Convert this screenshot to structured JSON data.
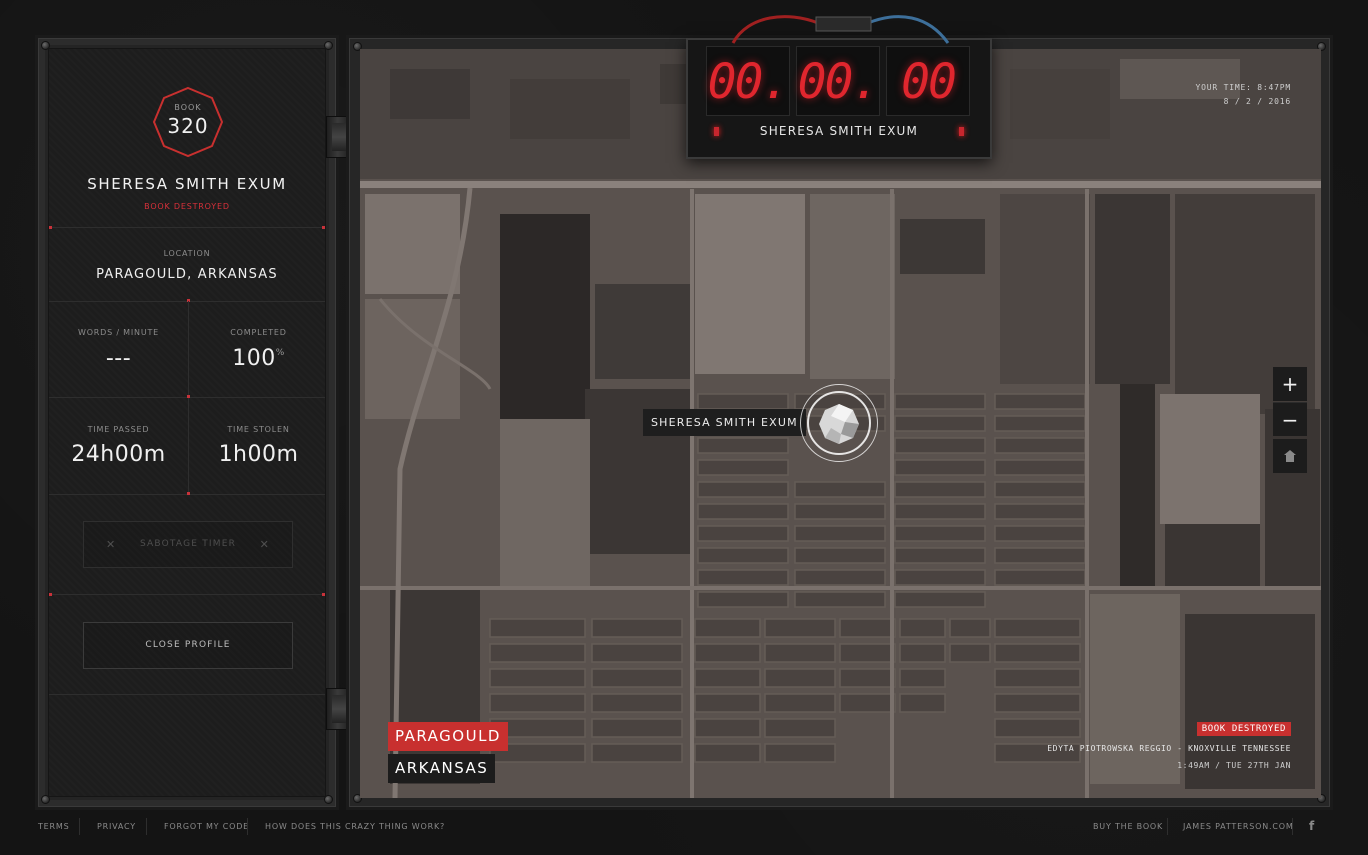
{
  "profile": {
    "book_label": "BOOK",
    "book_number": "320",
    "name": "SHERESA SMITH EXUM",
    "status": "BOOK DESTROYED",
    "location_label": "LOCATION",
    "location": "PARAGOULD, ARKANSAS",
    "words_per_minute_label": "WORDS / MINUTE",
    "words_per_minute": "---",
    "completed_label": "COMPLETED",
    "completed": "100",
    "completed_unit": "%",
    "time_passed_label": "TIME PASSED",
    "time_passed": "24h00m",
    "time_stolen_label": "TIME STOLEN",
    "time_stolen": "1h00m",
    "sabotage_button": "SABOTAGE TIMER",
    "close_button": "CLOSE PROFILE"
  },
  "timer": {
    "d1": "00.",
    "d2": "00.",
    "d3": "00",
    "name": "SHERESA SMITH EXUM"
  },
  "map": {
    "your_time": "YOUR TIME: 8:47PM",
    "date": "8 / 2 / 2016",
    "zoom_in": "+",
    "zoom_out": "−",
    "marker_label": "SHERESA SMITH EXUM",
    "city": "PARAGOULD",
    "state": "ARKANSAS",
    "notice_badge": "BOOK DESTROYED",
    "notice_line1": "EDYTA PIOTROWSKA REGGIO - KNOXVILLE TENNESSEE",
    "notice_line2": "1:49AM / TUE 27TH JAN"
  },
  "footer": {
    "terms": "TERMS",
    "privacy": "PRIVACY",
    "forgot_code": "FORGOT MY CODE",
    "how_it_works": "HOW DOES THIS CRAZY THING WORK?",
    "buy_book": "BUY THE BOOK",
    "site": "JAMES PATTERSON.COM",
    "facebook": "f"
  },
  "colors": {
    "accent_red": "#c8302f",
    "led_red": "#e0262e"
  },
  "icons": [
    "home-icon",
    "facebook-icon",
    "close-x-icon",
    "gem-marker-icon"
  ]
}
